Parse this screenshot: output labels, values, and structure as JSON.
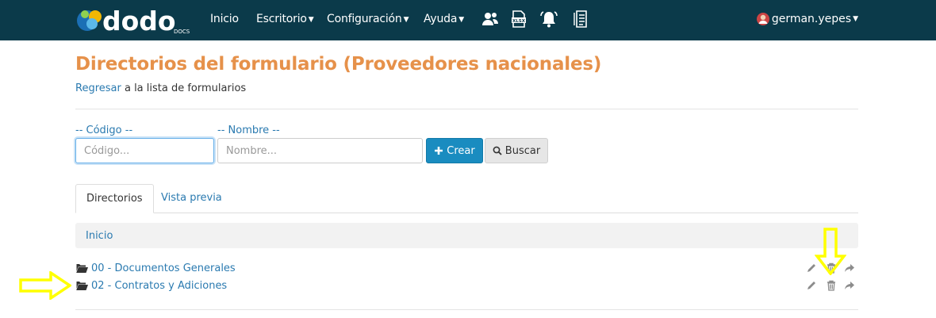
{
  "navbar": {
    "brand": "dodo",
    "brand_sub": "DOCS",
    "items": [
      {
        "label": "Inicio",
        "has_caret": false
      },
      {
        "label": "Escritorio",
        "has_caret": true
      },
      {
        "label": "Configuración",
        "has_caret": true
      },
      {
        "label": "Ayuda",
        "has_caret": true
      }
    ],
    "icons": [
      "users-icon",
      "xlsx-icon",
      "bell-icon",
      "document-list-icon"
    ],
    "user": "german.yepes"
  },
  "page": {
    "title": "Directorios del formulario (Proveedores nacionales)",
    "back_link": "Regresar",
    "back_rest": " a la lista de formularios"
  },
  "filters": {
    "code_label": "-- Código --",
    "code_placeholder": "Código...",
    "code_value": "",
    "name_label": "-- Nombre --",
    "name_placeholder": "Nombre...",
    "name_value": "",
    "create_label": "Crear",
    "search_label": "Buscar"
  },
  "tabs": [
    {
      "label": "Directorios",
      "active": true
    },
    {
      "label": "Vista previa",
      "active": false
    }
  ],
  "breadcrumb": "Inicio",
  "directories": [
    {
      "label": "00 - Documentos Generales",
      "actions": [
        "edit-icon",
        "trash-icon",
        "share-icon"
      ]
    },
    {
      "label": "02 - Contratos y Adiciones",
      "actions": [
        "edit-icon",
        "trash-icon",
        "share-icon"
      ]
    }
  ],
  "colors": {
    "navbar": "#0b3a4a",
    "title": "#e6914a",
    "link": "#2a7ab0",
    "primary_button": "#1a8cc0",
    "annotation_arrow": "#ffff00"
  }
}
